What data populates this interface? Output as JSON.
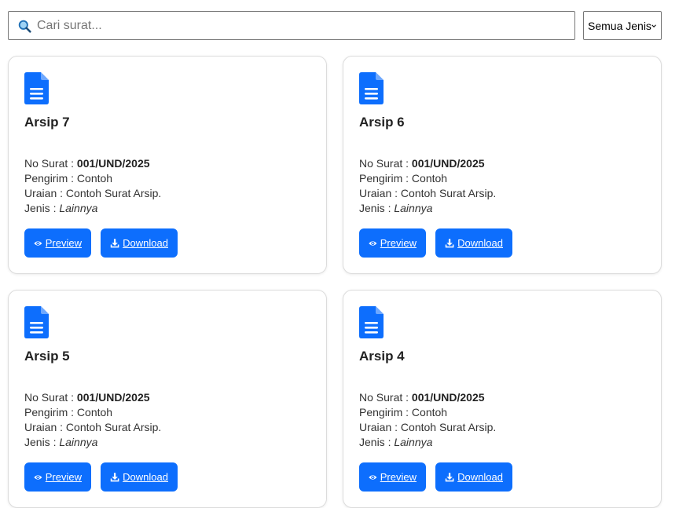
{
  "search": {
    "placeholder": "Cari surat...",
    "value": ""
  },
  "filter": {
    "selected": "Semua Jenis"
  },
  "labels": {
    "no_surat": "No Surat",
    "pengirim": "Pengirim",
    "uraian": "Uraian",
    "jenis": "Jenis",
    "separator": " : ",
    "preview": "Preview",
    "download": "Download"
  },
  "colors": {
    "accent": "#0d6efd"
  },
  "icons": {
    "search": "search-icon",
    "document": "document-icon",
    "preview": "eye-icon",
    "download": "download-icon"
  },
  "cards": [
    {
      "title": "Arsip 7",
      "no_surat": "001/UND/2025",
      "pengirim": "Contoh",
      "uraian": "Contoh Surat Arsip.",
      "jenis": "Lainnya"
    },
    {
      "title": "Arsip 6",
      "no_surat": "001/UND/2025",
      "pengirim": "Contoh",
      "uraian": "Contoh Surat Arsip.",
      "jenis": "Lainnya"
    },
    {
      "title": "Arsip 5",
      "no_surat": "001/UND/2025",
      "pengirim": "Contoh",
      "uraian": "Contoh Surat Arsip.",
      "jenis": "Lainnya"
    },
    {
      "title": "Arsip 4",
      "no_surat": "001/UND/2025",
      "pengirim": "Contoh",
      "uraian": "Contoh Surat Arsip.",
      "jenis": "Lainnya"
    }
  ]
}
